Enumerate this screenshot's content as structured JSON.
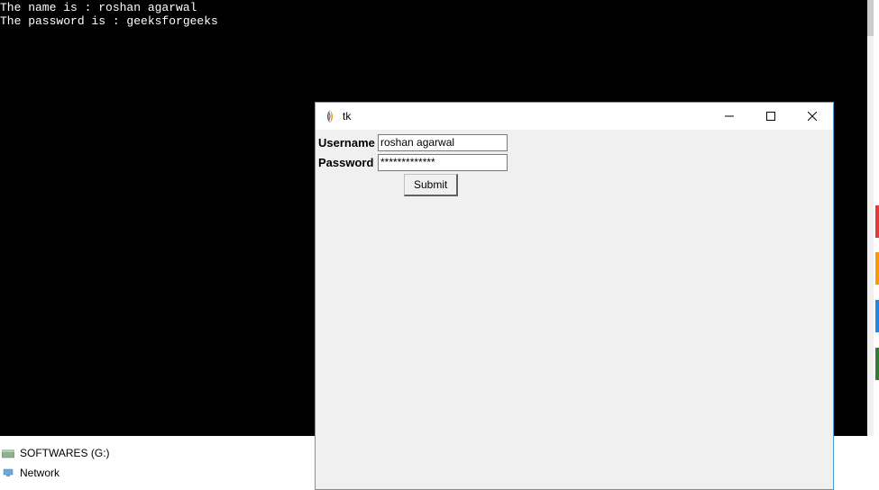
{
  "terminal": {
    "line1": "The name is : roshan agarwal",
    "line2": "The password is : geeksforgeeks"
  },
  "desktop": {
    "softwares_label": "SOFTWARES (G:)",
    "network_label": "Network"
  },
  "tk": {
    "title": "tk",
    "username_label": "Username",
    "password_label": "Password",
    "username_value": "roshan agarwal",
    "password_value": "*************",
    "submit_label": "Submit"
  }
}
